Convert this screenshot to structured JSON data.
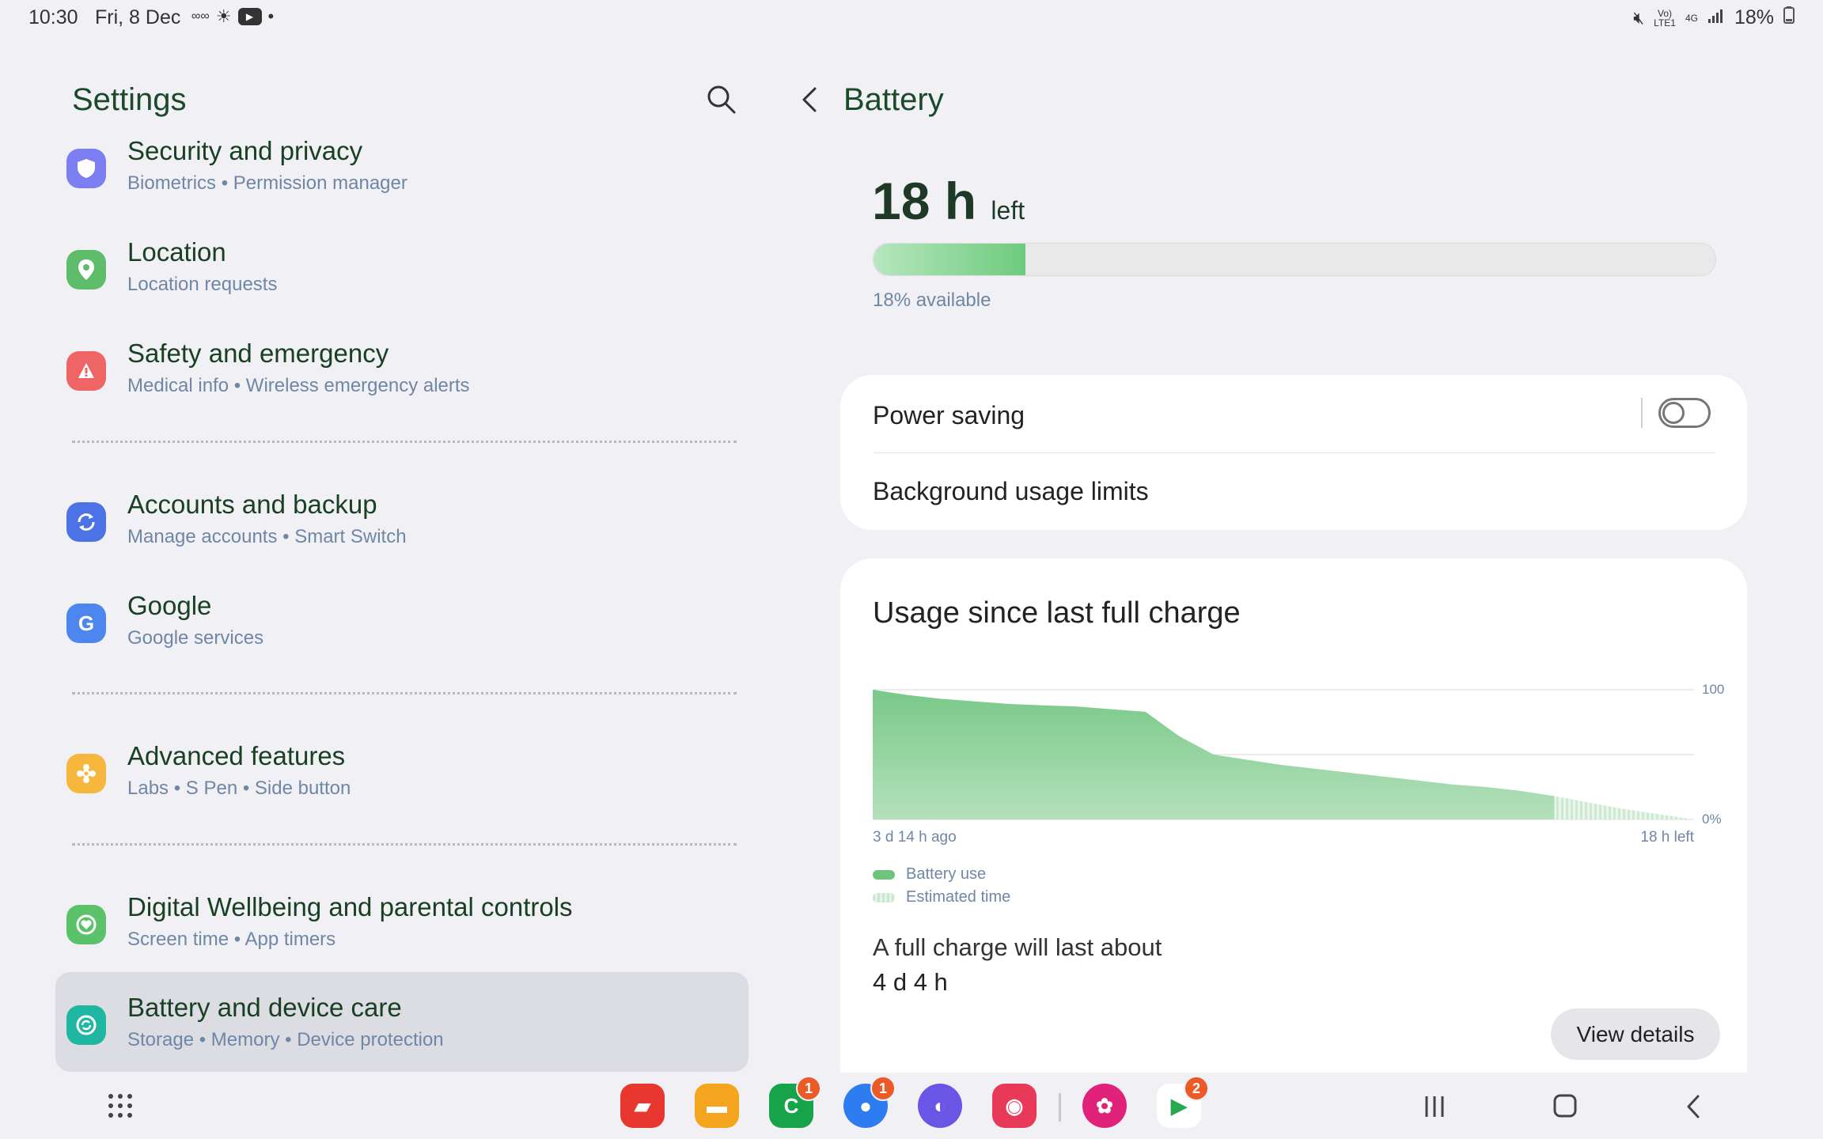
{
  "status_bar": {
    "time": "10:30",
    "date": "Fri, 8 Dec",
    "battery_percent": "18%",
    "network_label_top": "Vo)",
    "network_label_bottom": "LTE1",
    "network_type": "4G"
  },
  "settings": {
    "title": "Settings",
    "items": [
      {
        "title": "Security and privacy",
        "subtitle": "Biometrics  •  Permission manager",
        "icon": "shield-icon",
        "color": "#7b7ff2"
      },
      {
        "title": "Location",
        "subtitle": "Location requests",
        "icon": "location-pin-icon",
        "color": "#5ebc6a"
      },
      {
        "title": "Safety and emergency",
        "subtitle": "Medical info  •  Wireless emergency alerts",
        "icon": "alert-icon",
        "color": "#ef6565"
      },
      {
        "title": "Accounts and backup",
        "subtitle": "Manage accounts  •  Smart Switch",
        "icon": "sync-icon",
        "color": "#4c73e6"
      },
      {
        "title": "Google",
        "subtitle": "Google services",
        "icon": "google-icon",
        "color": "#4d86ee"
      },
      {
        "title": "Advanced features",
        "subtitle": "Labs  •  S Pen  •  Side button",
        "icon": "advanced-features-icon",
        "color": "#f6b73c"
      },
      {
        "title": "Digital Wellbeing and parental controls",
        "subtitle": "Screen time  •  App timers",
        "icon": "wellbeing-icon",
        "color": "#5cc26a"
      },
      {
        "title": "Battery and device care",
        "subtitle": "Storage  •  Memory  •  Device protection",
        "icon": "device-care-icon",
        "color": "#1fb7a2"
      }
    ]
  },
  "battery": {
    "title": "Battery",
    "time_left_value": "18 h",
    "time_left_suffix": "left",
    "level": 0.18,
    "available_text": "18% available",
    "power_saving_label": "Power saving",
    "power_saving_on": false,
    "background_limits_label": "Background usage limits",
    "usage_title": "Usage since last full charge",
    "legend_battery_use": "Battery use",
    "legend_estimated": "Estimated time",
    "full_charge_label": "A full charge will last about",
    "full_charge_value": "4 d 4 h",
    "view_details_label": "View details"
  },
  "chart_data": {
    "type": "area",
    "x_start_label": "3 d 14 h ago",
    "x_end_label": "18 h left",
    "y_max_label": "100",
    "y_min_label": "0%",
    "ylim": [
      0,
      100
    ],
    "grid": true,
    "series": [
      {
        "name": "Battery use",
        "color": "#6ec47d",
        "values": [
          100,
          96,
          93,
          91,
          89,
          88,
          87,
          85,
          83,
          64,
          50,
          46,
          42,
          39,
          36,
          33,
          30,
          27,
          25,
          22,
          18
        ]
      },
      {
        "name": "Estimated time",
        "color": "#c9e9cf",
        "values": [
          18,
          13,
          8,
          4,
          0
        ]
      }
    ]
  },
  "taskbar": {
    "apps": [
      {
        "name": "app-notes",
        "color": "#e8372f",
        "glyph": "▰",
        "badge": ""
      },
      {
        "name": "app-files",
        "color": "#f4a51d",
        "glyph": "▬",
        "badge": ""
      },
      {
        "name": "app-phone",
        "color": "#16a34a",
        "glyph": "C",
        "badge": "1"
      },
      {
        "name": "app-messages",
        "color": "#2d7cf0",
        "glyph": "●",
        "badge": "1"
      },
      {
        "name": "app-browser",
        "color": "#6b55e6",
        "glyph": "◐",
        "badge": ""
      },
      {
        "name": "app-camera",
        "color": "#e83a58",
        "glyph": "◉",
        "badge": ""
      },
      {
        "name": "app-gallery",
        "color": "#e0227a",
        "glyph": "✿",
        "badge": ""
      },
      {
        "name": "app-play-store",
        "color": "#ffffff",
        "glyph": "▶",
        "badge": "2"
      }
    ]
  }
}
